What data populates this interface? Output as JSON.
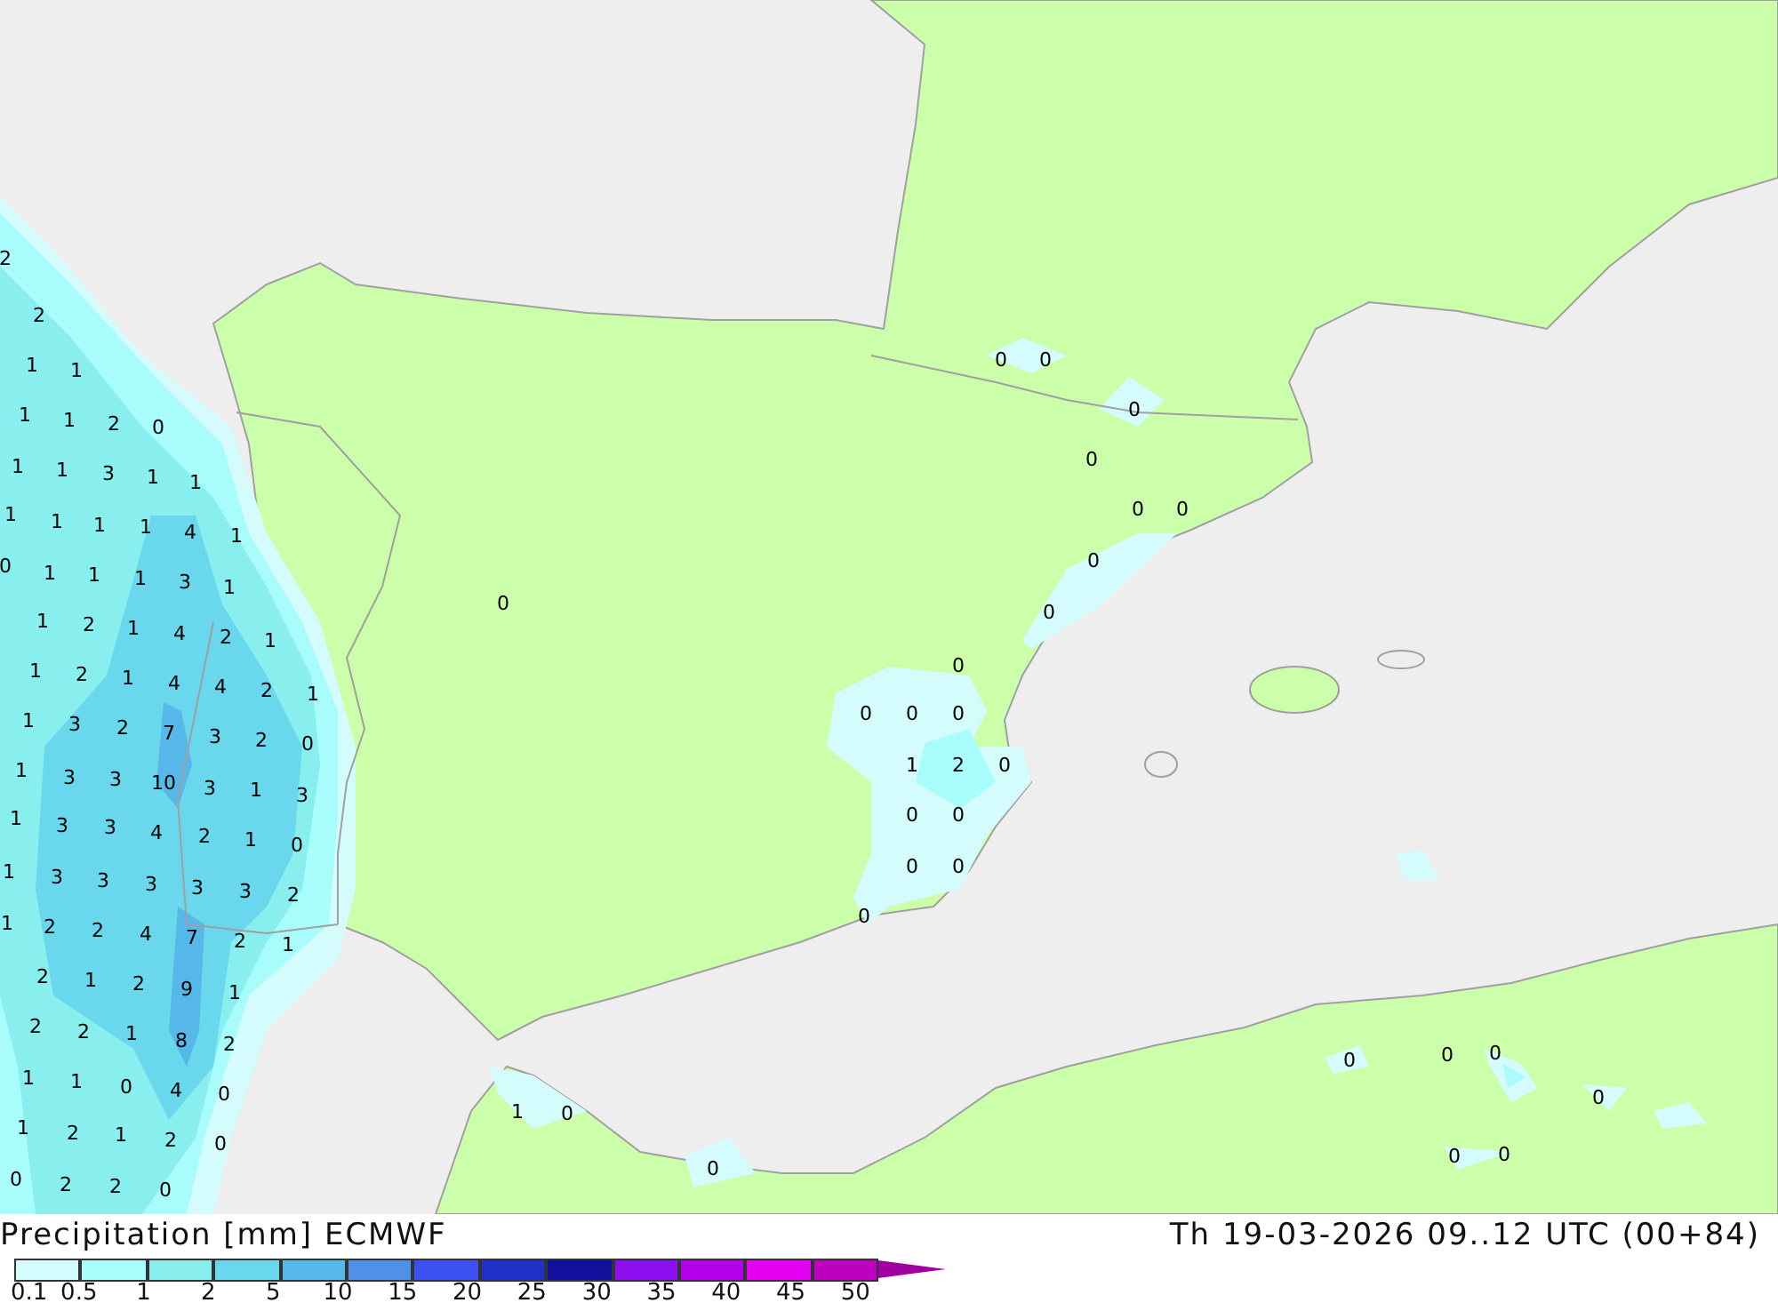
{
  "map": {
    "values": [
      "2",
      "2",
      "1",
      "1",
      "1",
      "1",
      "2",
      "0",
      "1",
      "1",
      "3",
      "1",
      "1",
      "1",
      "1",
      "1",
      "1",
      "4",
      "1",
      "0",
      "1",
      "1",
      "1",
      "3",
      "1",
      "1",
      "2",
      "1",
      "4",
      "2",
      "1",
      "1",
      "2",
      "1",
      "4",
      "4",
      "2",
      "1",
      "1",
      "3",
      "2",
      "7",
      "3",
      "2",
      "0",
      "1",
      "3",
      "3",
      "10",
      "3",
      "1",
      "3",
      "1",
      "3",
      "3",
      "4",
      "2",
      "1",
      "0",
      "1",
      "3",
      "3",
      "3",
      "3",
      "3",
      "2",
      "1",
      "2",
      "2",
      "4",
      "7",
      "2",
      "1",
      "2",
      "1",
      "2",
      "9",
      "1",
      "2",
      "2",
      "1",
      "8",
      "2",
      "1",
      "1",
      "0",
      "4",
      "0",
      "1",
      "2",
      "1",
      "2",
      "0",
      "0",
      "2",
      "2",
      "0",
      "0",
      "0",
      "0",
      "0",
      "0",
      "0",
      "0",
      "0",
      "0",
      "0",
      "0",
      "0",
      "0",
      "1",
      "2",
      "0",
      "0",
      "0",
      "0",
      "0",
      "0",
      "1",
      "0",
      "0",
      "0",
      "0",
      "0",
      "0",
      "0",
      "0"
    ]
  },
  "footer": {
    "title": "Precipitation [mm] ECMWF",
    "valid_time": "Th 19-03-2026 09..12 UTC (00+84)"
  },
  "legend": {
    "bins": [
      {
        "color": "#d4fcfc"
      },
      {
        "color": "#a8fcfc"
      },
      {
        "color": "#88eeee"
      },
      {
        "color": "#6ad8ec"
      },
      {
        "color": "#56b8e8"
      },
      {
        "color": "#5090e8"
      },
      {
        "color": "#3c50f0"
      },
      {
        "color": "#2030c8"
      },
      {
        "color": "#10109c"
      },
      {
        "color": "#8c10f0"
      },
      {
        "color": "#b400e8"
      },
      {
        "color": "#e400f0"
      },
      {
        "color": "#c000c0"
      }
    ],
    "arrow": {
      "color": "#a000a0"
    },
    "ticks": [
      "0.1",
      "0.5",
      "1",
      "2",
      "5",
      "10",
      "15",
      "20",
      "25",
      "30",
      "35",
      "40",
      "45",
      "50"
    ]
  }
}
